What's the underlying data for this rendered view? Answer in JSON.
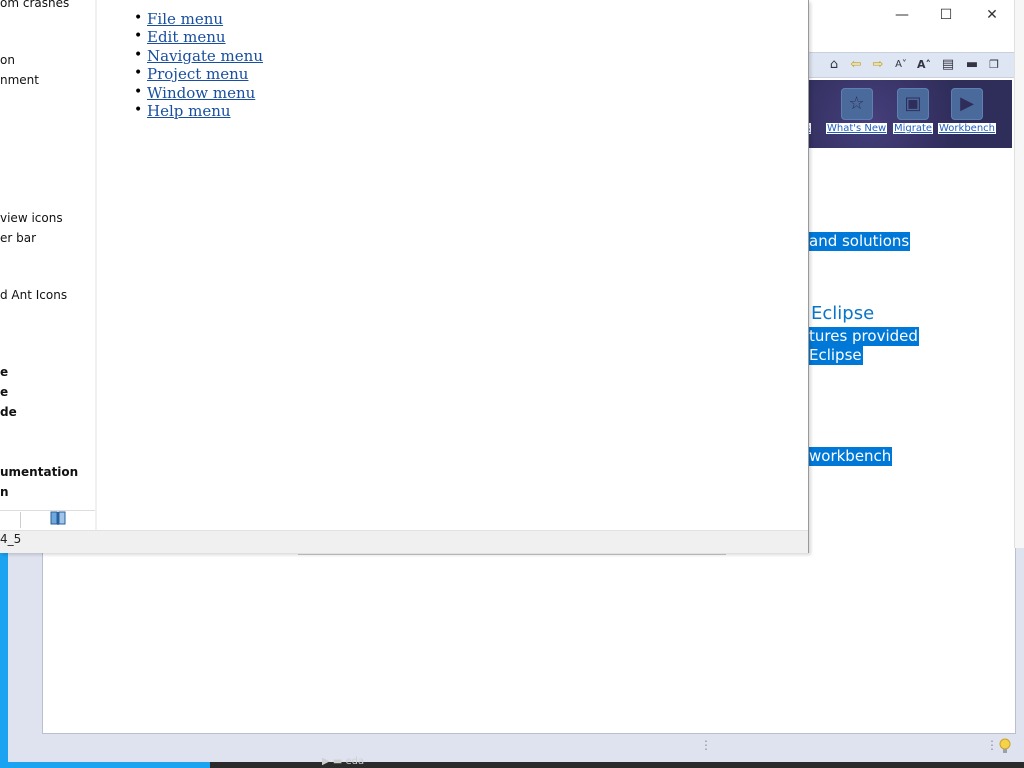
{
  "help_window": {
    "toc": {
      "items": [
        {
          "label": "om crashes",
          "bold": false
        },
        {
          "label": "on",
          "bold": false
        },
        {
          "label": "nment",
          "bold": false
        },
        {
          "label": "view icons",
          "bold": false
        },
        {
          "label": "er bar",
          "bold": false
        },
        {
          "label": "d Ant Icons",
          "bold": false
        },
        {
          "label": "e",
          "bold": true
        },
        {
          "label": "e",
          "bold": true
        },
        {
          "label": "de",
          "bold": true
        },
        {
          "label": "umentation",
          "bold": true
        },
        {
          "label": "n",
          "bold": true
        }
      ]
    },
    "status_text": "4_5",
    "content": {
      "links": [
        "File menu",
        "Edit menu",
        "Navigate menu",
        "Project menu",
        "Window menu",
        "Help menu"
      ]
    }
  },
  "welcome_window": {
    "controls": {
      "minimize": "—",
      "maximize": "☐",
      "close": "✕"
    },
    "toolbar_icons": [
      "home-icon",
      "back-icon",
      "forward-icon",
      "decrease-font-icon",
      "increase-font-icon",
      "toggle-toc-icon",
      "minimize-view-icon",
      "restore-view-icon"
    ],
    "banner": {
      "partial_label": "es",
      "items": [
        {
          "label": "What's New",
          "icon": "star-icon"
        },
        {
          "label": "Migrate",
          "icon": "suitcase-icon"
        },
        {
          "label": "Workbench",
          "icon": "play-icon"
        }
      ]
    },
    "texts": {
      "solutions": "and solutions",
      "eclipse_heading": "Eclipse",
      "features": "tures provided",
      "eclipse_small": "Eclipse",
      "workbench": "workbench"
    }
  },
  "taskbar": {
    "item": "eda"
  },
  "colors": {
    "accent_blue": "#0078d7",
    "link": "#1a4fa0",
    "desktop_blue": "#1aa3f0",
    "banner_bg": "#2f2d5a"
  }
}
